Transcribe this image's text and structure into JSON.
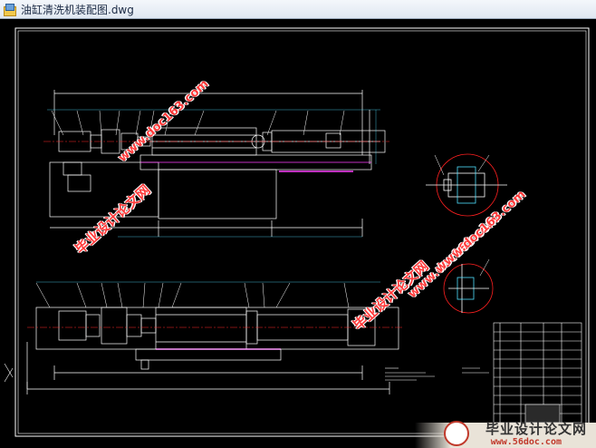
{
  "window": {
    "title": "油缸清洗机装配图.dwg",
    "icon": "dwg-file-icon"
  },
  "watermarks": {
    "diagonal_1": "www.doc163.com",
    "diagonal_2": "毕业设计论文网",
    "diagonal_3": "www.doc163.com",
    "diagonal_4": "毕业设计论文网",
    "diagonal_5": "www.doc163.com",
    "footer_title": "毕业设计论文网",
    "footer_url": "www.56doc.com"
  },
  "colors": {
    "drawing_line": "#ffffff",
    "dimension": "#4fe0ff",
    "section_circle": "#ff2020",
    "hatch": "#ff40ff",
    "watermark_text": "#ff3b3b"
  }
}
